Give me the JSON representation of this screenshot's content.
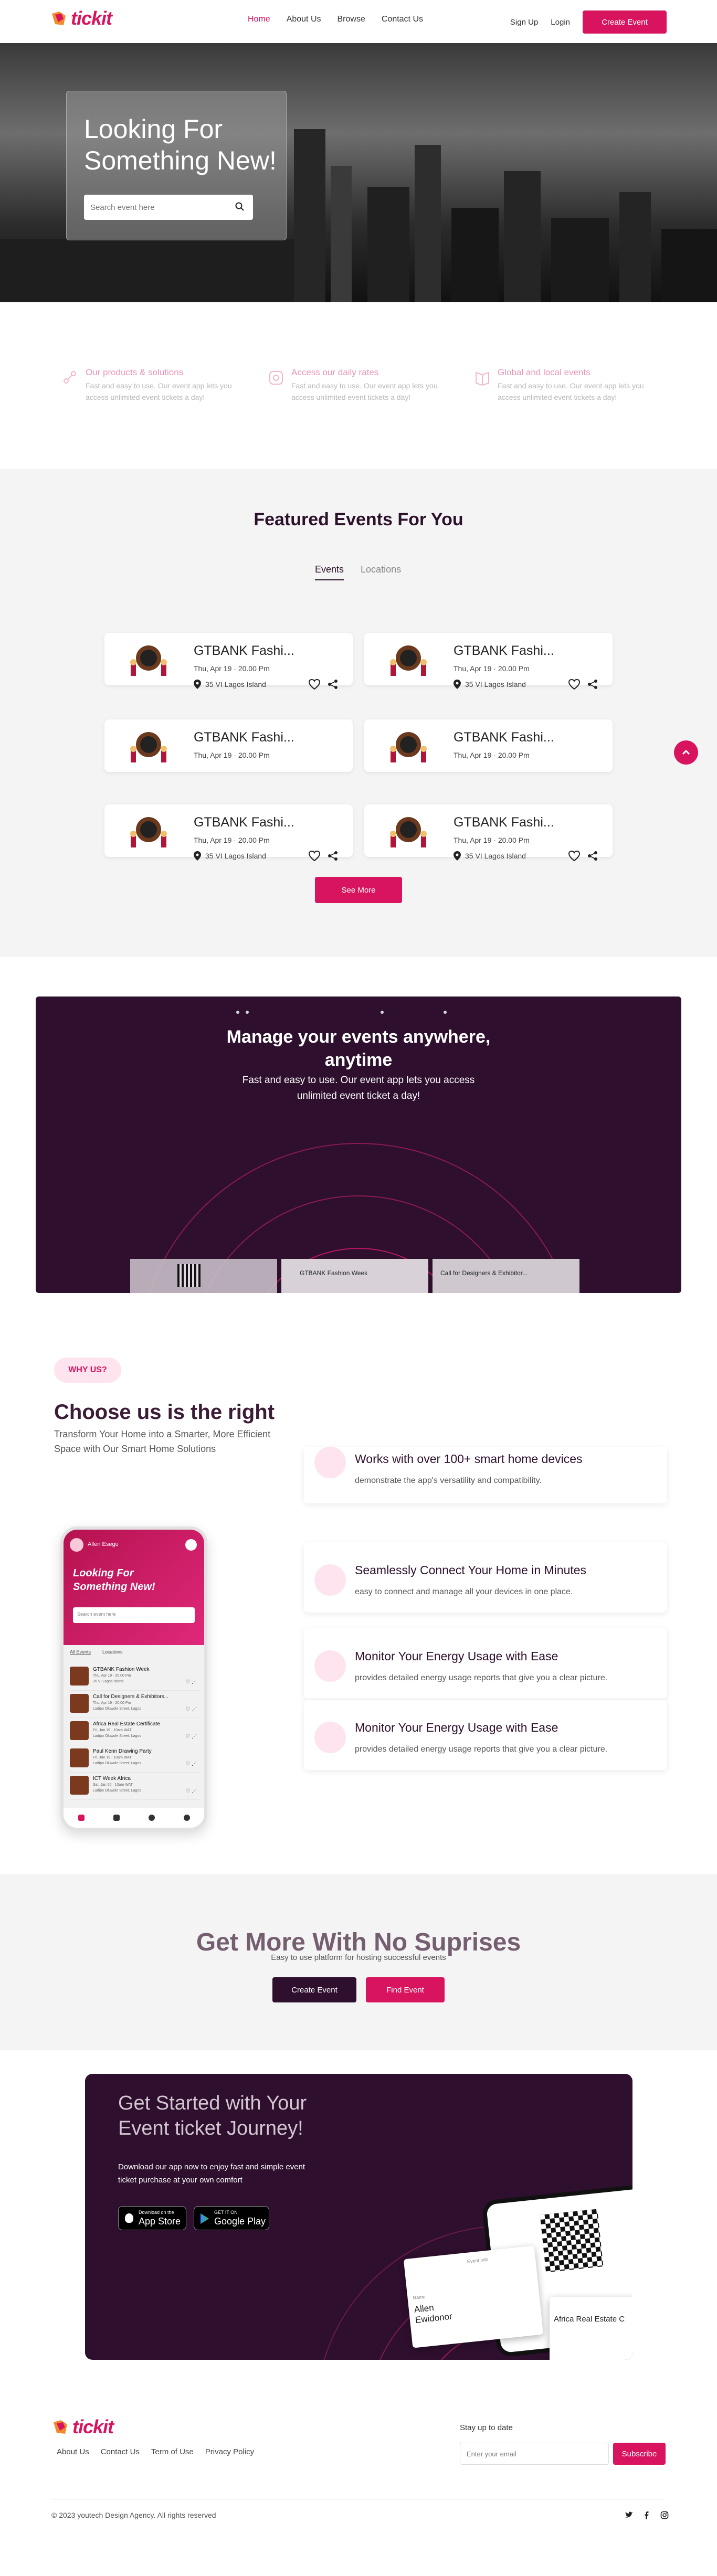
{
  "nav": {
    "logo": "tickit",
    "links": [
      "Home",
      "About Us",
      "Browse",
      "Contact Us"
    ],
    "active": "Home",
    "signup": "Sign Up",
    "login": "Login",
    "create_event": "Create Event"
  },
  "hero": {
    "title": "Looking For Something New!",
    "search_placeholder": "Search event here"
  },
  "features": [
    {
      "title": "Our products & solutions",
      "desc": "Fast and easy to use. Our event app lets you access unlimited event tickets a day!"
    },
    {
      "title": "Access our daily rates",
      "desc": "Fast and easy to use. Our event app lets you access unlimited event tickets a day!"
    },
    {
      "title": "Global and local events",
      "desc": "Fast and easy to use. Our event app lets you access unlimited event tickets a day!"
    }
  ],
  "events": {
    "title": "Featured Events For You",
    "tabs": [
      "Events",
      "Locations"
    ],
    "cards": [
      {
        "title": "GTBANK Fashi...",
        "date": "Thu, Apr 19 · 20.00 Pm",
        "location": "35 VI Lagos Island"
      },
      {
        "title": "GTBANK Fashi...",
        "date": "Thu, Apr 19 · 20.00 Pm",
        "location": "35 VI Lagos Island"
      },
      {
        "title": "GTBANK Fashi...",
        "date": "Thu, Apr 19 · 20.00 Pm",
        "location": ""
      },
      {
        "title": "GTBANK Fashi...",
        "date": "Thu, Apr 19 · 20.00 Pm",
        "location": ""
      },
      {
        "title": "GTBANK Fashi...",
        "date": "Thu, Apr 19 · 20.00 Pm",
        "location": "35 VI Lagos Island"
      },
      {
        "title": "GTBANK Fashi...",
        "date": "Thu, Apr 19 · 20.00 Pm",
        "location": "35 VI Lagos Island"
      }
    ],
    "see_more": "See More"
  },
  "manage": {
    "title": "Manage your events anywhere, anytime",
    "subtitle": "Fast and easy to use. Our event app lets you access unlimited event ticket a day!",
    "preview": [
      "GTBANK Fashion Week",
      "Call for Designers & Exhibitor..."
    ]
  },
  "why": {
    "badge": "WHY US?",
    "title": "Choose us is the right",
    "subtitle": "Transform Your Home into a Smarter, More Efficient Space with Our Smart Home Solutions",
    "features": [
      {
        "title": "Works with over 100+ smart home devices",
        "desc": "demonstrate the app's versatility and compatibility."
      },
      {
        "title": "Seamlessly Connect Your Home in Minutes",
        "desc": "easy to connect and manage all your devices in one place."
      },
      {
        "title": "Monitor Your Energy Usage with Ease",
        "desc": "provides detailed energy usage reports that give you a clear picture."
      },
      {
        "title": "Monitor Your Energy Usage with Ease",
        "desc": "provides detailed energy usage reports that give you a clear picture."
      }
    ],
    "phone": {
      "user": "Allen Esegu",
      "hero": "Looking For Something New!",
      "search": "Search event here",
      "tabs": [
        "All Events",
        "Locations"
      ],
      "list": [
        {
          "title": "GTBANK Fashion Week",
          "date": "Thu, Apr 19 · 20.00 Pm",
          "loc": "35 VI Lagos Island"
        },
        {
          "title": "Call for Designers & Exhibitors...",
          "date": "Thu, Apr 19 · 20.00 Pm",
          "loc": "Ladipo Oluwole Street, Lagos"
        },
        {
          "title": "Africa Real Estate Certificate",
          "date": "Fri, Jan 19 · 10am WAT",
          "loc": "Ladipo Oluwole Street, Lagos"
        },
        {
          "title": "Paul Kenn Drawing Party",
          "date": "Fri, Jan 19 · 10am WAT",
          "loc": "Ladipo Oluwole Street, Lagos"
        },
        {
          "title": "ICT Week Africa",
          "date": "Sat, Jan 20 · 10am WAT",
          "loc": "Ladipo Oluwole Street, Lagos"
        }
      ]
    }
  },
  "cta": {
    "title": "Get More With No Suprises",
    "subtitle": "Easy to use platform for hosting successful events",
    "create": "Create Event",
    "find": "Find Event"
  },
  "journey": {
    "title": "Get Started with Your Event ticket Journey!",
    "desc": "Download our app now to enjoy fast and simple event ticket purchase at your own comfort",
    "appstore_small": "Download on the",
    "appstore": "App Store",
    "play_small": "GET IT ON",
    "play": "Google Play",
    "ticket_name": "Allen Ewidonor",
    "ticket_event": "Africa Real Estate C",
    "ticket_label": "Name",
    "ticket_label2": "Event Info"
  },
  "footer": {
    "logo": "tickit",
    "links": [
      "About Us",
      "Contact Us",
      "Term of Use",
      "Privacy Policy"
    ],
    "newsletter_title": "Stay up to date",
    "email_placeholder": "Enter your email",
    "subscribe": "Subscribe",
    "copyright": "© 2023 youtech Design Agency. All rights reserved"
  },
  "colors": {
    "accent": "#d8145e",
    "dark": "#2e0f2e"
  }
}
